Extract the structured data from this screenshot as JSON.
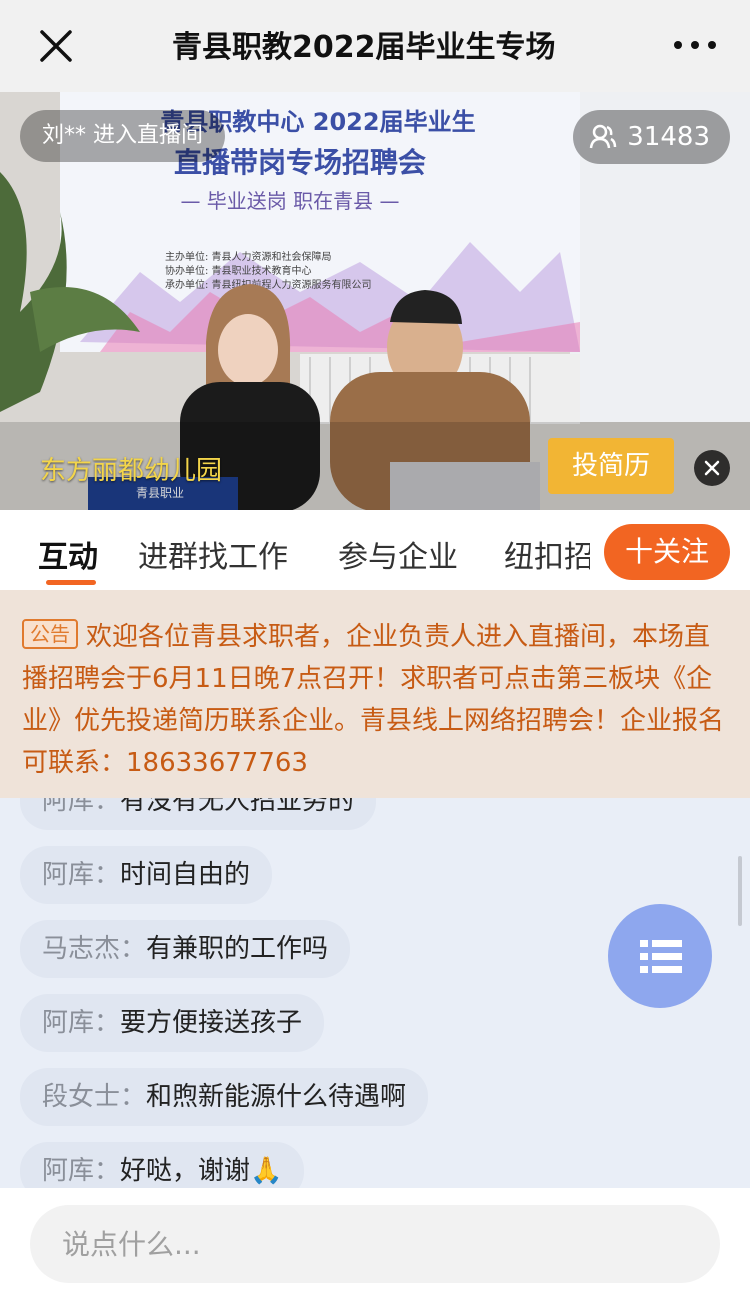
{
  "header": {
    "title": "青县职教2022届毕业生专场",
    "close_icon": "close-icon",
    "more_icon": "more-dots-icon"
  },
  "video": {
    "join_notice": "刘**  进入直播间",
    "viewer_count": "31483",
    "viewer_icon": "viewers-icon",
    "banner_line1": "青县职教中心 2022届毕业生",
    "banner_line2": "直播带岗专场招聘会",
    "banner_line3": "— 毕业送岗  职在青县 —",
    "banner_org1": "主办单位:  青县人力资源和社会保障局",
    "banner_org2": "协办单位:  青县职业技术教育中心",
    "banner_org3": "承办单位:  青县纽扣前程人力资源服务有限公司",
    "desk_sign": "青县职业",
    "company_name": "东方丽都幼儿园",
    "resume_button": "投简历"
  },
  "tabs": {
    "items": [
      "互动",
      "进群找工作",
      "参与企业",
      "纽扣招"
    ],
    "active_index": 0,
    "follow_button": "十关注"
  },
  "notice": {
    "tag": "公告",
    "text": "欢迎各位青县求职者，企业负责人进入直播间，本场直播招聘会于6月11日晚7点召开！求职者可点击第三板块《企业》优先投递简历联系企业。青县线上网络招聘会！企业报名可联系：18633677763"
  },
  "chat": {
    "messages": [
      {
        "user": "阿库：",
        "text": "有没有无人招业务的"
      },
      {
        "user": "阿库：",
        "text": "时间自由的"
      },
      {
        "user": "马志杰：",
        "text": "有兼职的工作吗"
      },
      {
        "user": "阿库：",
        "text": "要方便接送孩子"
      },
      {
        "user": "段女士：",
        "text": "和煦新能源什么待遇啊"
      },
      {
        "user": "阿库：",
        "text": "好哒，谢谢🙏"
      }
    ]
  },
  "input": {
    "placeholder": "说点什么..."
  },
  "colors": {
    "accent": "#f26522",
    "resume": "#f2b534",
    "notice_text": "#c75b14",
    "fab": "#8ea7ee"
  }
}
